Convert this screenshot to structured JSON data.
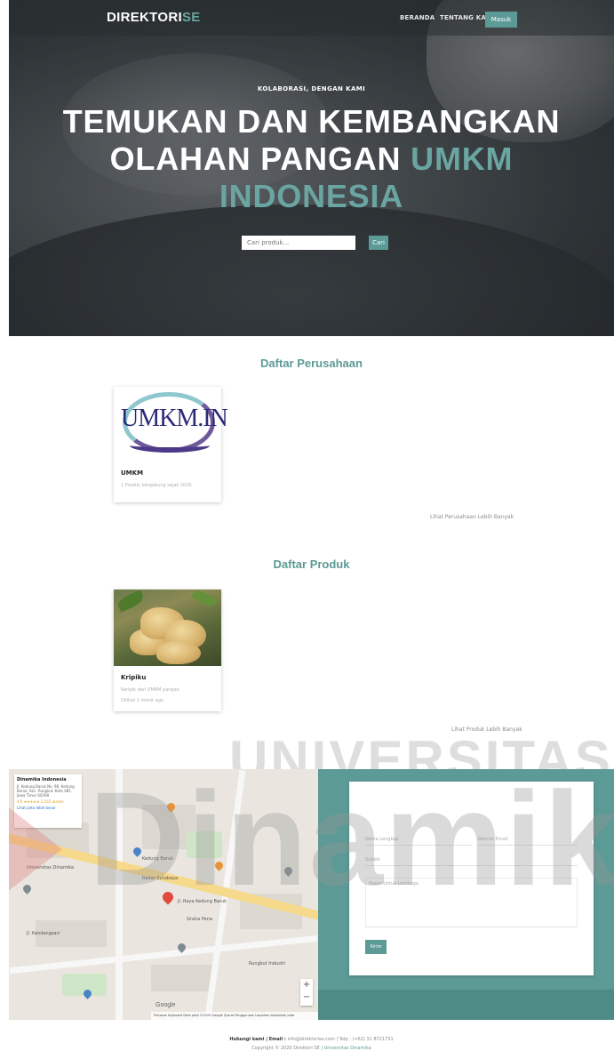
{
  "nav": {
    "brand_main": "DIREKTORI",
    "brand_accent": "SE",
    "home": "BERANDA",
    "about": "TENTANG KAMI",
    "login": "Masuk"
  },
  "hero": {
    "kicker": "KOLABORASI, DENGAN KAMI",
    "line1": "TEMUKAN DAN KEMBANGKAN",
    "line2_main": "OLAHAN PANGAN",
    "line2_accent": "UMKM",
    "line3_accent": "INDONESIA",
    "search_placeholder": "Cari produk...",
    "search_button": "Cari"
  },
  "companies": {
    "title": "Daftar Perusahaan",
    "items": [
      {
        "logo_text": "UMKM.IN",
        "name": "UMKM",
        "meta": "1 Produk bergabung sejak 2020"
      }
    ],
    "more": "Lihat Perusahaan Lebih Banyak"
  },
  "products": {
    "title": "Daftar Produk",
    "items": [
      {
        "name": "Kripiku",
        "meta1": "Keripik dari UMKM pangan",
        "meta2": "Dilihat 1 menit ago"
      }
    ],
    "more": "Lihat Produk Lebih Banyak"
  },
  "watermark": {
    "top": "UNIVERSITAS",
    "bottom": "Dinamika"
  },
  "map": {
    "info_title": "Dinamika Indonesia",
    "info_desc": "Jl. Kedung Baruk No. 98, Kedung Baruk, Kec. Rungkut, Kota SBY, Jawa Timur 60298",
    "info_rating": "4,6 ★★★★★  1.165 ulasan",
    "info_link": "Lihat peta lebih besar",
    "labels": [
      "Universitas Dinamika",
      "Kedung Baruk",
      "Jl. Raya Kedung Baruk",
      "Radar Surabaya",
      "Jl. Kendangsari",
      "Graha Pena",
      "Rungkut Industri"
    ],
    "attribution": "Pintasan keyboard   Data peta ©2020 Google   Syarat Penggunaan   Laporkan kesalahan peta",
    "google": "Google",
    "zoom_in": "+",
    "zoom_out": "−"
  },
  "contact": {
    "name_placeholder": "Nama Lengkap",
    "email_placeholder": "Alamat Email",
    "subject_placeholder": "Subjek",
    "message_placeholder": "Pesan Untuk Lembaga",
    "send": "Kirim"
  },
  "footer": {
    "contact_label": "Hubungi kami | Email :",
    "contact_detail": "info@direktorise.com | Telp : (+62) 31 8721731",
    "copyright": "Copyright © 2020 Direktori SE |",
    "credit": "Universitas Dinamika"
  },
  "colors": {
    "accent": "#5c9a96",
    "hero_dark": "#2f3437"
  }
}
